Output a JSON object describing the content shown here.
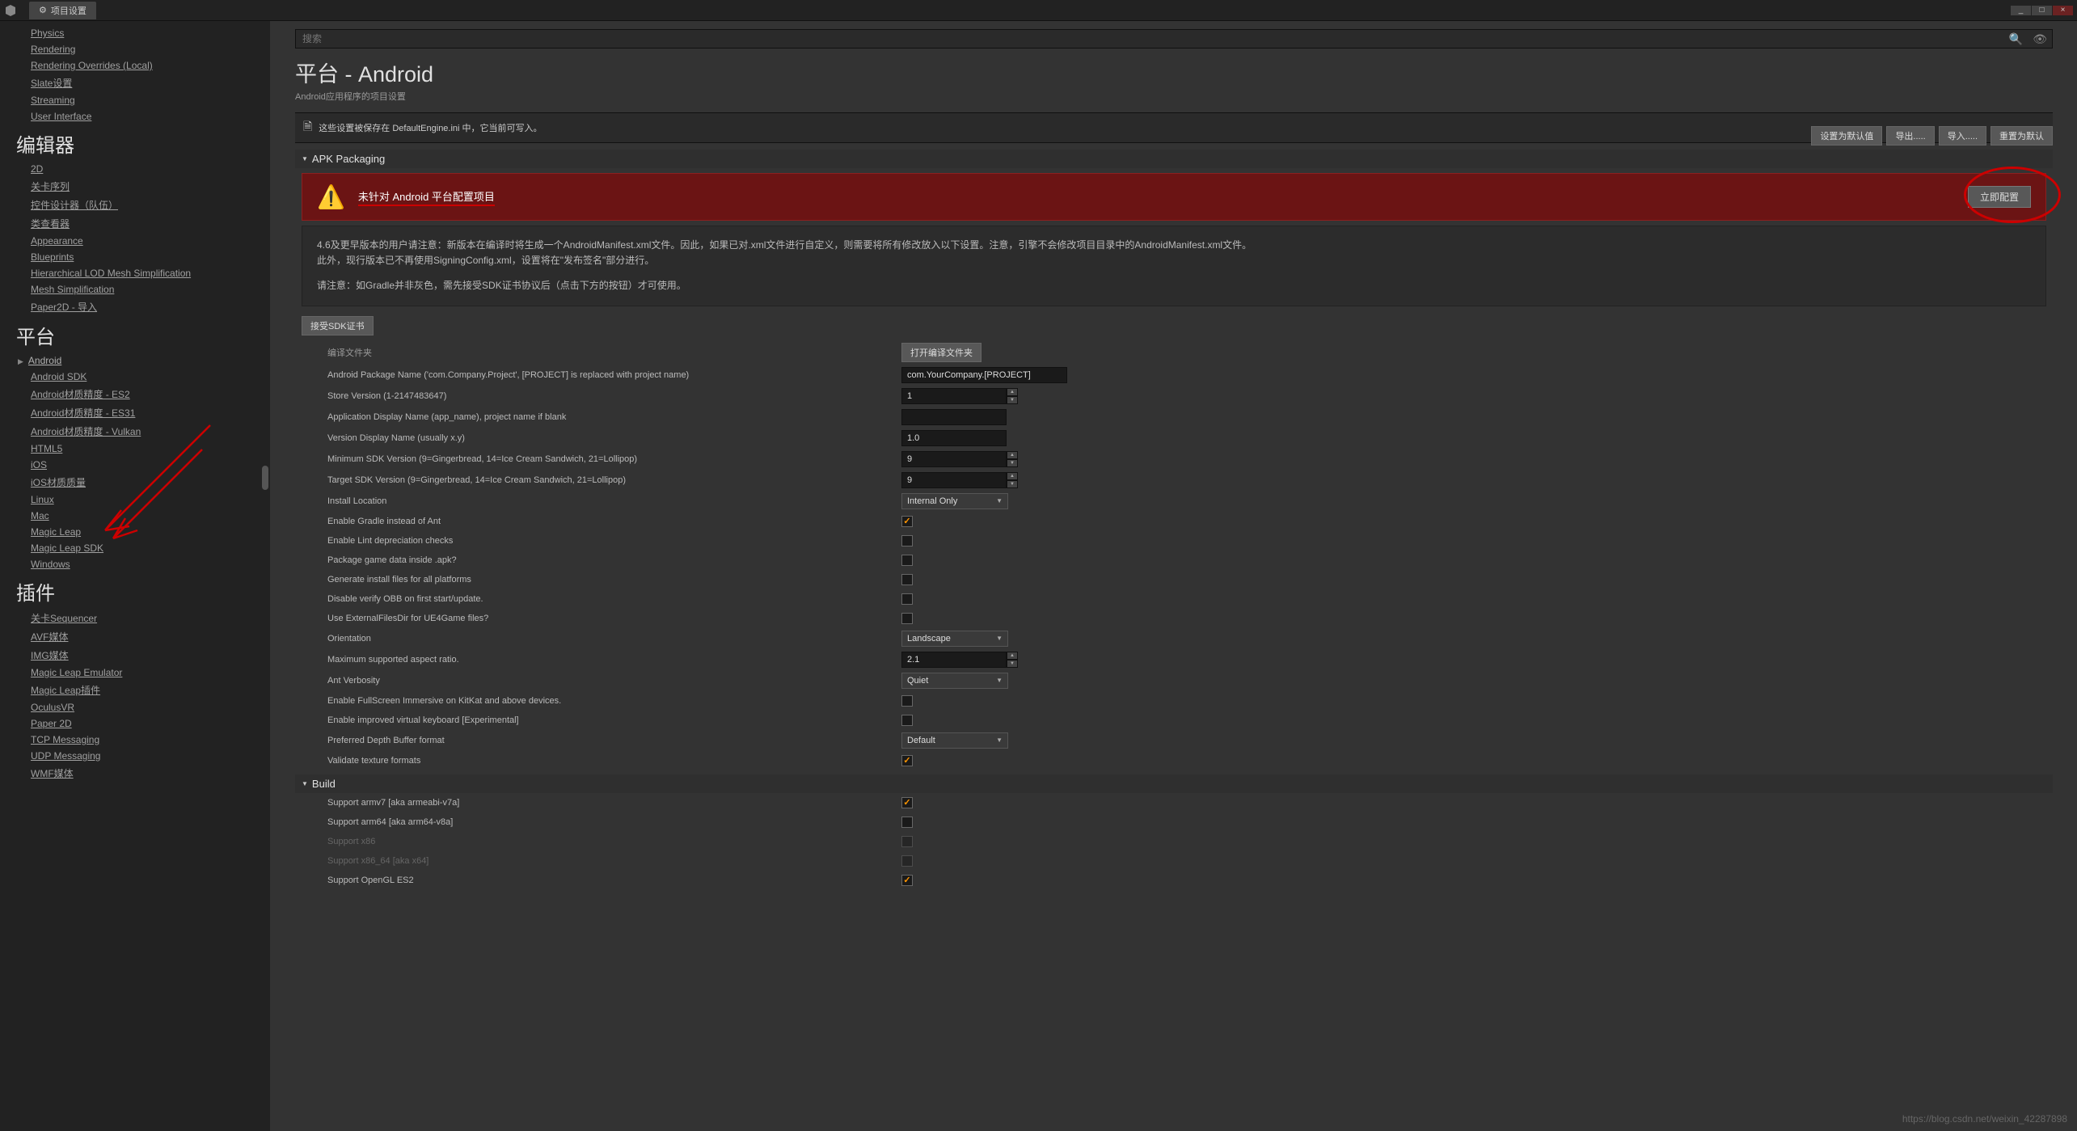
{
  "title_tab": "项目设置",
  "win": {
    "min": "_",
    "max": "□",
    "close": "×"
  },
  "search_placeholder": "搜索",
  "page_title": "平台 - Android",
  "page_sub": "Android应用程序的项目设置",
  "top_buttons": {
    "a": "设置为默认值",
    "b": "导出.....",
    "c": "导入.....",
    "d": "重置为默认"
  },
  "info_line": "这些设置被保存在 DefaultEngine.ini 中，它当前可写入。",
  "apk_section": "APK Packaging",
  "red_banner": {
    "text": "未针对 Android 平台配置项目",
    "btn": "立即配置"
  },
  "note": {
    "l1": "4.6及更早版本的用户请注意：新版本在编译时将生成一个AndroidManifest.xml文件。因此，如果已对.xml文件进行自定义，则需要将所有修改放入以下设置。注意，引擎不会修改项目目录中的AndroidManifest.xml文件。",
    "l2": "此外，现行版本已不再使用SigningConfig.xml，设置将在\"发布签名\"部分进行。",
    "l3": "请注意：如Gradle并非灰色，需先接受SDK证书协议后（点击下方的按钮）才可使用。"
  },
  "accept_sdk_btn": "接受SDK证书",
  "build_folder": {
    "label": "编译文件夹",
    "btn": "打开编译文件夹"
  },
  "props": {
    "pkg": {
      "l": "Android Package Name ('com.Company.Project', [PROJECT] is replaced with project name)",
      "v": "com.YourCompany.[PROJECT]"
    },
    "store": {
      "l": "Store Version (1-2147483647)",
      "v": "1"
    },
    "appname": {
      "l": "Application Display Name (app_name), project name if blank",
      "v": ""
    },
    "verdisp": {
      "l": "Version Display Name (usually x.y)",
      "v": "1.0"
    },
    "minsdk": {
      "l": "Minimum SDK Version (9=Gingerbread, 14=Ice Cream Sandwich, 21=Lollipop)",
      "v": "9"
    },
    "tgtsdk": {
      "l": "Target SDK Version (9=Gingerbread, 14=Ice Cream Sandwich, 21=Lollipop)",
      "v": "9"
    },
    "install": {
      "l": "Install Location",
      "v": "Internal Only"
    },
    "gradle": {
      "l": "Enable Gradle instead of Ant"
    },
    "lint": {
      "l": "Enable Lint depreciation checks"
    },
    "pkggame": {
      "l": "Package game data inside .apk?"
    },
    "genfiles": {
      "l": "Generate install files for all platforms"
    },
    "disobb": {
      "l": "Disable verify OBB on first start/update."
    },
    "extfiles": {
      "l": "Use ExternalFilesDir for UE4Game files?"
    },
    "orient": {
      "l": "Orientation",
      "v": "Landscape"
    },
    "aspect": {
      "l": "Maximum supported aspect ratio.",
      "v": "2.1"
    },
    "antverb": {
      "l": "Ant Verbosity",
      "v": "Quiet"
    },
    "fullscreen": {
      "l": "Enable FullScreen Immersive on KitKat and above devices."
    },
    "vkeyboard": {
      "l": "Enable improved virtual keyboard [Experimental]"
    },
    "depth": {
      "l": "Preferred Depth Buffer format",
      "v": "Default"
    },
    "validate": {
      "l": "Validate texture formats"
    }
  },
  "build_section": "Build",
  "build_props": {
    "armv7": "Support armv7 [aka armeabi-v7a]",
    "arm64": "Support arm64 [aka arm64-v8a]",
    "x86": "Support x86",
    "x86_64": "Support x86_64 [aka x64]",
    "es2": "Support OpenGL ES2"
  },
  "sidebar": {
    "items1": [
      "Physics",
      "Rendering",
      "Rendering Overrides (Local)",
      "Slate设置",
      "Streaming",
      "User Interface"
    ],
    "cat_editor": "编辑器",
    "items2": [
      "2D",
      "关卡序列",
      "控件设计器（队伍）",
      "类查看器",
      "Appearance",
      "Blueprints",
      "Hierarchical LOD Mesh Simplification",
      "Mesh Simplification",
      "Paper2D - 导入"
    ],
    "cat_platform": "平台",
    "items3": [
      "Android",
      "Android SDK",
      "Android材质精度 - ES2",
      "Android材质精度 - ES31",
      "Android材质精度 - Vulkan",
      "HTML5",
      "iOS",
      "iOS材质质量",
      "Linux",
      "Mac",
      "Magic Leap",
      "Magic Leap SDK",
      "Windows"
    ],
    "cat_plugin": "插件",
    "items4": [
      "关卡Sequencer",
      "AVF媒体",
      "IMG媒体",
      "Magic Leap Emulator",
      "Magic Leap插件",
      "OculusVR",
      "Paper 2D",
      "TCP Messaging",
      "UDP Messaging",
      "WMF媒体"
    ]
  },
  "watermark": "https://blog.csdn.net/weixin_42287898"
}
